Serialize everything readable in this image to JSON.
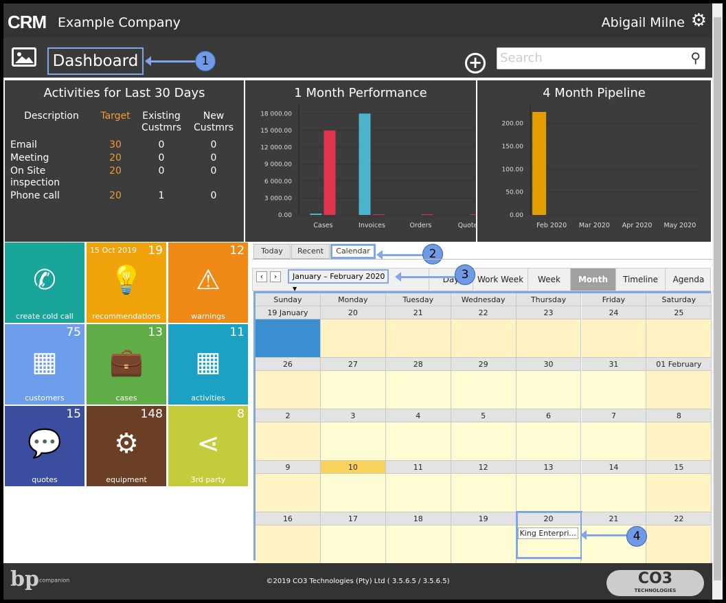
{
  "header": {
    "logo": "CRM",
    "company": "Example Company",
    "user": "Abigail Milne",
    "settings_icon": "gear-icon"
  },
  "toolbar": {
    "page_title": "Dashboard",
    "search_placeholder": "Search",
    "add_icon": "plus-circle-icon",
    "image_icon": "image-icon"
  },
  "callouts": [
    "1",
    "2",
    "3",
    "4"
  ],
  "activities": {
    "title": "Activities for Last 30 Days",
    "headers": [
      "Description",
      "Target",
      "Existing Custmrs",
      "New Custmrs"
    ],
    "rows": [
      [
        "Email",
        "30",
        "0",
        "0"
      ],
      [
        "Meeting",
        "20",
        "0",
        "0"
      ],
      [
        "On Site inspection",
        "20",
        "0",
        "0"
      ],
      [
        "Phone call",
        "20",
        "1",
        "0"
      ]
    ],
    "target_color": "#f39c2b"
  },
  "chart_data": [
    {
      "type": "bar",
      "title": "1 Month Performance",
      "categories": [
        "Cases",
        "Invoices",
        "Orders",
        "Quotes"
      ],
      "ylim": [
        0,
        19500
      ],
      "yticks": [
        "0.00",
        "3 000.00",
        "6 000.00",
        "9 000.00",
        "12 000.00",
        "15 000.00",
        "18 000.00"
      ],
      "ytick_values": [
        0,
        3000,
        6000,
        9000,
        12000,
        15000,
        18000
      ],
      "series": [
        {
          "color": "#4bb3cc",
          "values": [
            250,
            18000,
            0,
            0
          ]
        },
        {
          "color": "#e0344e",
          "values": [
            15000,
            50,
            30,
            30
          ]
        }
      ],
      "grid": true
    },
    {
      "type": "bar",
      "title": "4 Month Pipeline",
      "categories": [
        "Feb 2020",
        "Mar 2020",
        "Apr 2020",
        "May 2020"
      ],
      "ylim": [
        0,
        240
      ],
      "yticks": [
        "0.00",
        "50.00",
        "100.00",
        "150.00",
        "200.00"
      ],
      "ytick_values": [
        0,
        50,
        100,
        150,
        200
      ],
      "series": [
        {
          "color": "#e1a000",
          "values": [
            225,
            0,
            0,
            0
          ]
        }
      ],
      "grid": true
    }
  ],
  "tiles": [
    {
      "label": "create cold call",
      "num": "",
      "date": "",
      "color": "#1aa59b",
      "icon": "phone-icon",
      "glyph": "✆"
    },
    {
      "label": "recommendations",
      "num": "19",
      "date": "15 Oct 2019",
      "color": "#f0a30a",
      "icon": "lightbulb-icon",
      "glyph": "💡"
    },
    {
      "label": "warnings",
      "num": "12",
      "date": "",
      "color": "#ef8a17",
      "icon": "warning-icon",
      "glyph": "⚠"
    },
    {
      "label": "customers",
      "num": "75",
      "date": "",
      "color": "#6d9eeb",
      "icon": "building-icon",
      "glyph": "▦"
    },
    {
      "label": "cases",
      "num": "13",
      "date": "",
      "color": "#5fad47",
      "icon": "briefcase-icon",
      "glyph": "💼"
    },
    {
      "label": "activities",
      "num": "11",
      "date": "",
      "color": "#1ba1c4",
      "icon": "calendar-icon",
      "glyph": "▦"
    },
    {
      "label": "quotes",
      "num": "15",
      "date": "",
      "color": "#3a4d9e",
      "icon": "speech-bubbles-icon",
      "glyph": "💬"
    },
    {
      "label": "equipment",
      "num": "148",
      "date": "",
      "color": "#6b3e26",
      "icon": "gears-icon",
      "glyph": "⚙"
    },
    {
      "label": "3rd party",
      "num": "8",
      "date": "",
      "color": "#c4cc3b",
      "icon": "share-icon",
      "glyph": "⋖"
    }
  ],
  "tabs": [
    "Today",
    "Recent",
    "Calendar"
  ],
  "calendar": {
    "range": "January – February 2020",
    "views": [
      "Day",
      "Work Week",
      "Week",
      "Month",
      "Timeline",
      "Agenda"
    ],
    "active_view": "Month",
    "weekdays": [
      "Sunday",
      "Monday",
      "Tuesday",
      "Wednesday",
      "Thursday",
      "Friday",
      "Saturday"
    ],
    "weeks": [
      [
        "19 January",
        "20",
        "21",
        "22",
        "23",
        "24",
        "25"
      ],
      [
        "26",
        "27",
        "28",
        "29",
        "30",
        "31",
        "01 February"
      ],
      [
        "2",
        "3",
        "4",
        "5",
        "6",
        "7",
        "8"
      ],
      [
        "9",
        "10",
        "11",
        "12",
        "13",
        "14",
        "15"
      ],
      [
        "16",
        "17",
        "18",
        "19",
        "20",
        "21",
        "22"
      ]
    ],
    "today": "10",
    "event": {
      "label": "King Enterpri...",
      "day": "20"
    }
  },
  "footer": {
    "copyright": "©2019 CO3 Technologies (Pty) Ltd ( 3.5.6.5 / 3.5.6.5)",
    "left_logo": "bp companion application",
    "right_logo": "CO3 TECHNOLOGIES"
  }
}
